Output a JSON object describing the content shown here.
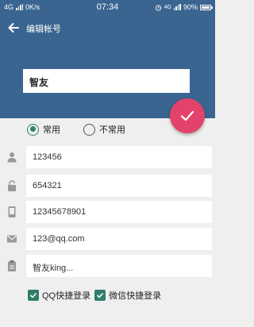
{
  "status_bar": {
    "network": "4G",
    "speed": "0K/s",
    "time": "07:34",
    "network_right": "4G",
    "battery": "90%"
  },
  "header": {
    "title": "编辑帐号",
    "name_value": "智友"
  },
  "usage": {
    "options": [
      "常用",
      "不常用"
    ],
    "selected": "常用"
  },
  "fields": {
    "account": "123456",
    "password": "654321",
    "phone": "12345678901",
    "email": "123@qq.com",
    "note": "智友king..."
  },
  "quick_login": {
    "qq_label": "QQ快捷登录",
    "qq_checked": true,
    "wechat_label": "微信快捷登录",
    "wechat_checked": true
  },
  "colors": {
    "header": "#3a6591",
    "fab": "#e3436a",
    "accent": "#33836c",
    "background": "#efefef"
  }
}
